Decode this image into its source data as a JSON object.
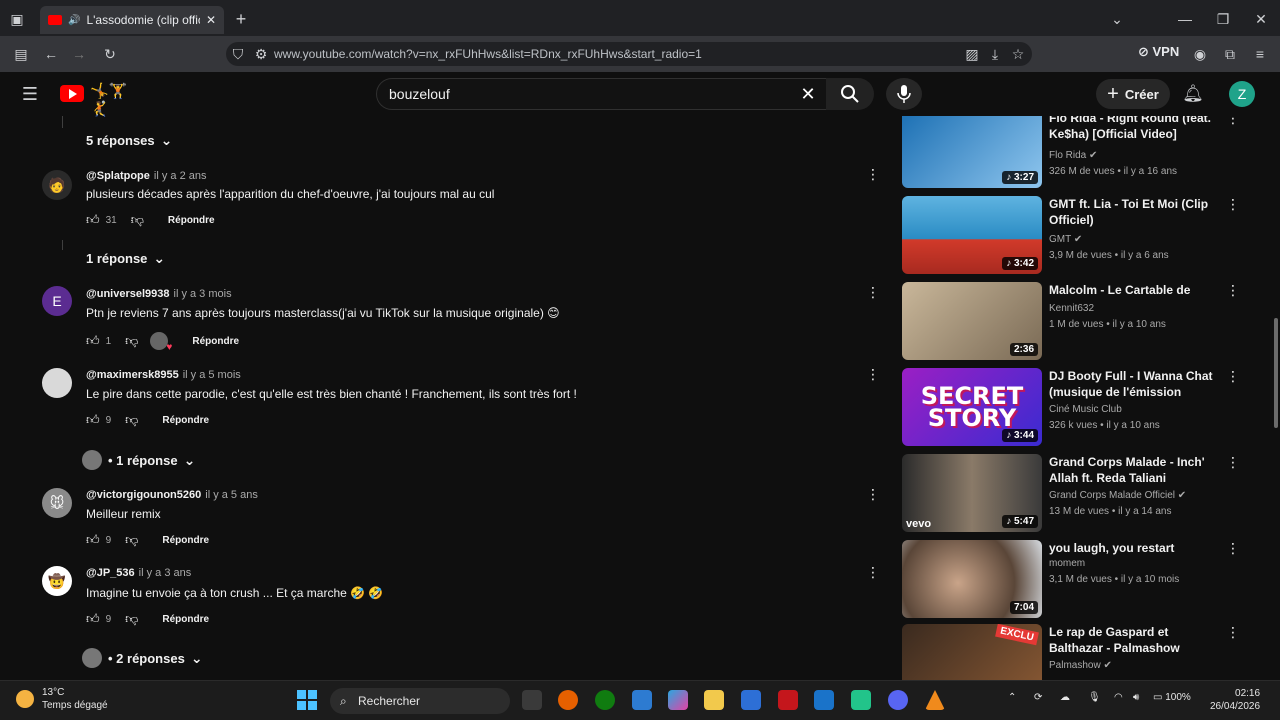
{
  "browser": {
    "tab_title": "L'assodomie (clip officiel) -",
    "url": "www.youtube.com/watch?v=nx_rxFUhHws&list=RDnx_rxFUhHws&start_radio=1",
    "vpn_label": "VPN"
  },
  "youtube": {
    "search_value": "bouzelouf",
    "create_label": "Créer",
    "avatar_letter": "Z"
  },
  "comments": {
    "toggles": [
      {
        "label": "5 réponses"
      },
      {
        "label": "1 réponse"
      },
      {
        "label": "• 1 réponse"
      },
      {
        "label": "• 2 réponses"
      }
    ],
    "items": [
      {
        "handle": "@Splatpope",
        "when": "il y a 2 ans",
        "text": "plusieurs décades après l'apparition du chef-d'oeuvre, j'ai toujours mal au cul",
        "likes": "31",
        "reply": "Répondre"
      },
      {
        "handle": "@universel9938",
        "when": "il y a 3 mois",
        "text": "Ptn je reviens 7 ans après toujours masterclass(j'ai vu TikTok sur la musique originale) 😊",
        "likes": "1",
        "reply": "Répondre",
        "avatar_letter": "E"
      },
      {
        "handle": "@maximersk8955",
        "when": "il y a 5 mois",
        "text": "Le pire dans cette parodie, c'est qu'elle est très bien chanté ! Franchement, ils sont très fort !",
        "likes": "9",
        "reply": "Répondre"
      },
      {
        "handle": "@victorgigounon5260",
        "when": "il y a 5 ans",
        "text": "Meilleur remix",
        "likes": "9",
        "reply": "Répondre"
      },
      {
        "handle": "@JP_536",
        "when": "il y a 3 ans",
        "text": "Imagine tu envoie ça à ton crush ... Et ça marche 🤣 🤣",
        "likes": "9",
        "reply": "Répondre"
      }
    ]
  },
  "sidebar": {
    "videos": [
      {
        "title": "Flo Rida - Right Round (feat. Ke$ha) [Official Video]",
        "channel": "Flo Rida",
        "meta": "326 M de vues • il y a 16 ans",
        "duration": "3:27",
        "verified": true
      },
      {
        "title": "GMT ft. Lia - Toi Et Moi (Clip Officiel)",
        "channel": "GMT",
        "meta": "3,9 M de vues • il y a 6 ans",
        "duration": "3:42",
        "verified": true
      },
      {
        "title": "Malcolm - Le Cartable de Dewey",
        "channel": "Kennit632",
        "meta": "1 M de vues • il y a 10 ans",
        "duration": "2:36",
        "verified": false
      },
      {
        "title": "DJ Booty Full - I Wanna Chat (musique de l'émission \"Secret…",
        "channel": "Ciné Music Club",
        "meta": "326 k vues • il y a 10 ans",
        "duration": "3:44",
        "verified": false,
        "thumb_text": "SECRET STORY"
      },
      {
        "title": "Grand Corps Malade - Inch' Allah ft. Reda Taliani",
        "channel": "Grand Corps Malade Officiel",
        "meta": "13 M de vues • il y a 14 ans",
        "duration": "5:47",
        "verified": true,
        "thumb_text": "vevo"
      },
      {
        "title": "you laugh, you restart",
        "channel": "momem",
        "meta": "3,1 M de vues • il y a 10 mois",
        "duration": "7:04",
        "verified": false
      },
      {
        "title": "Le rap de Gaspard et Balthazar - Palmashow",
        "channel": "Palmashow",
        "meta": "",
        "duration": "",
        "verified": true,
        "thumb_text": "EXCLU"
      }
    ]
  },
  "taskbar": {
    "temp": "13°C",
    "weather": "Temps dégagé",
    "search_label": "Rechercher",
    "battery": "100%",
    "time": "02:16",
    "date": "26/04/2026"
  }
}
